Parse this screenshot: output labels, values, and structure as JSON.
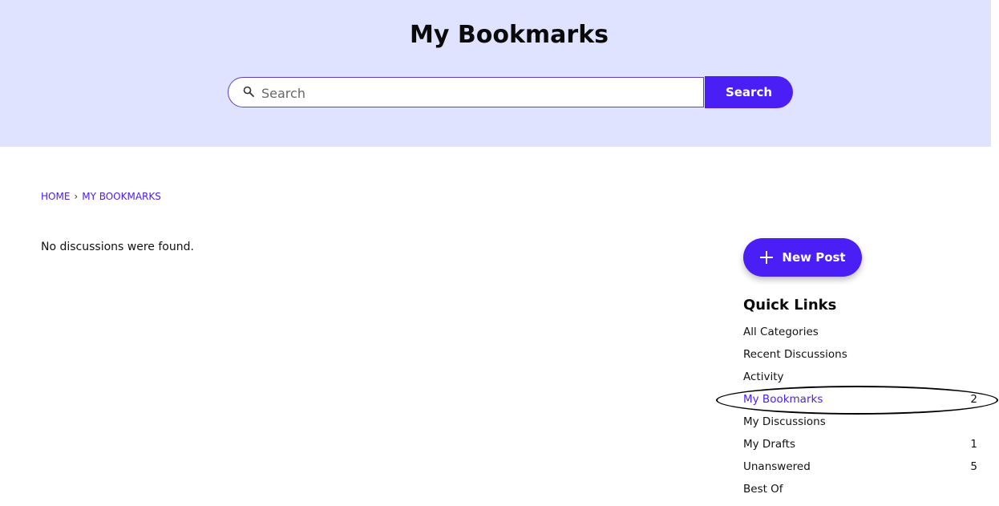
{
  "header": {
    "title": "My Bookmarks"
  },
  "search": {
    "placeholder": "Search",
    "button_label": "Search"
  },
  "breadcrumb": {
    "home": "HOME",
    "separator": "›",
    "current": "MY BOOKMARKS"
  },
  "main": {
    "empty_message": "No discussions were found."
  },
  "sidebar": {
    "new_post_label": "New Post",
    "quick_links_title": "Quick Links",
    "items": [
      {
        "label": "All Categories",
        "count": ""
      },
      {
        "label": "Recent Discussions",
        "count": ""
      },
      {
        "label": "Activity",
        "count": ""
      },
      {
        "label": "My Bookmarks",
        "count": "2"
      },
      {
        "label": "My Discussions",
        "count": ""
      },
      {
        "label": "My Drafts",
        "count": "1"
      },
      {
        "label": "Unanswered",
        "count": "5"
      },
      {
        "label": "Best Of",
        "count": ""
      }
    ]
  },
  "colors": {
    "accent": "#4a1ff5",
    "banner": "#dfe3ff"
  },
  "icons": {
    "search": "search-icon",
    "plus": "plus-icon"
  }
}
